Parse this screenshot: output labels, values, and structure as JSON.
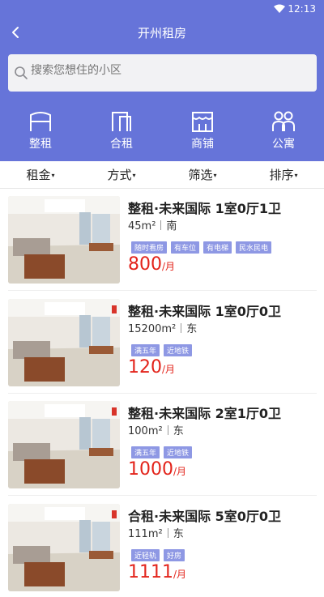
{
  "status": {
    "time": "12:13"
  },
  "nav": {
    "title": "开州租房"
  },
  "search": {
    "placeholder": "搜索您想住的小区"
  },
  "categories": [
    {
      "label": "整租",
      "icon": "whole-rent-icon"
    },
    {
      "label": "合租",
      "icon": "shared-rent-icon"
    },
    {
      "label": "商铺",
      "icon": "shop-icon"
    },
    {
      "label": "公寓",
      "icon": "apartment-icon"
    }
  ],
  "filters": [
    {
      "label": "租金"
    },
    {
      "label": "方式"
    },
    {
      "label": "筛选"
    },
    {
      "label": "排序"
    }
  ],
  "listings": [
    {
      "title": "整租·未来国际 1室0厅1卫",
      "area": "45m²",
      "direction": "南",
      "tags": [
        "随时看房",
        "有车位",
        "有电梯",
        "民水民电"
      ],
      "price": "800",
      "unit": "/月"
    },
    {
      "title": "整租·未来国际 1室0厅0卫",
      "area": "15200m²",
      "direction": "东",
      "tags": [
        "满五年",
        "近地铁"
      ],
      "price": "120",
      "unit": "/月"
    },
    {
      "title": "整租·未来国际 2室1厅0卫",
      "area": "100m²",
      "direction": "东",
      "tags": [
        "满五年",
        "近地铁"
      ],
      "price": "1000",
      "unit": "/月"
    },
    {
      "title": "合租·未来国际 5室0厅0卫",
      "area": "111m²",
      "direction": "东",
      "tags": [
        "近轻轨",
        "好房"
      ],
      "price": "1111",
      "unit": "/月"
    }
  ],
  "colors": {
    "brand": "#6674d9",
    "price": "#e3241b",
    "tag": "#8e98e4"
  }
}
